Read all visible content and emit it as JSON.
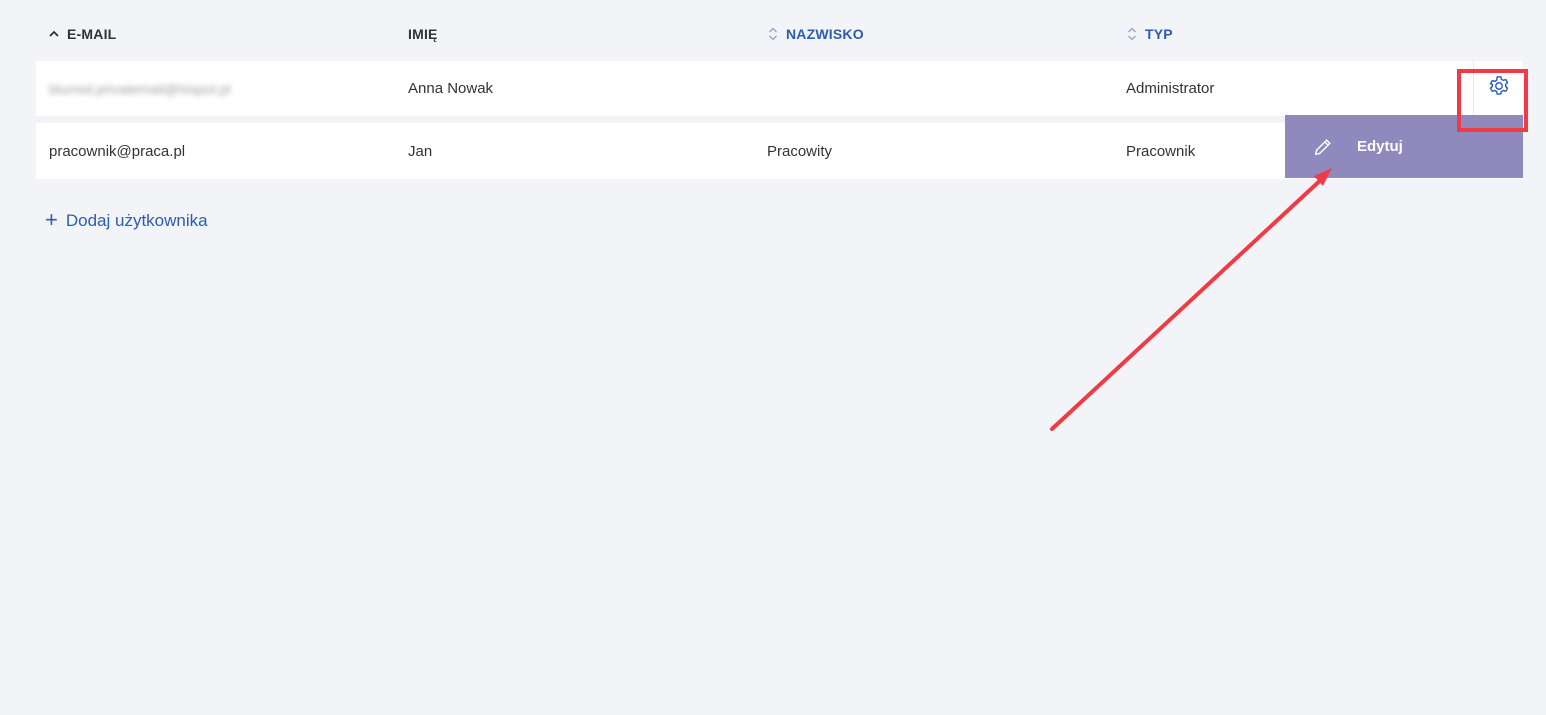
{
  "table": {
    "columns": {
      "email": "E-MAIL",
      "first_name": "IMIĘ",
      "last_name": "NAZWISKO",
      "type": "TYP"
    },
    "rows": [
      {
        "email": "blurred.privatemail@hispot.pl",
        "first_name": "Anna Nowak",
        "last_name": "",
        "type": "Administrator"
      },
      {
        "email": "pracownik@praca.pl",
        "first_name": "Jan",
        "last_name": "Pracowity",
        "type": "Pracownik"
      }
    ]
  },
  "row_menu": {
    "edit_label": "Edytuj"
  },
  "actions": {
    "add_user_label": "Dodaj użytkownika",
    "add_user_symbol": "+"
  },
  "icons": {
    "sort_asc": "chevron-up-icon",
    "sort_both": "sort-updown-icon",
    "settings": "gear-icon",
    "edit": "pencil-icon"
  },
  "colors": {
    "accent": "#2c5cb0",
    "menu_bg": "#8f89bd",
    "highlight": "#ee3b45",
    "page_bg": "#f3f4f8"
  }
}
